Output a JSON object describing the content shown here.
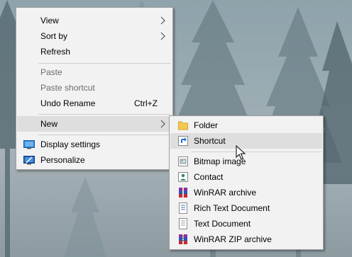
{
  "context_menu": {
    "items": [
      {
        "label": "View"
      },
      {
        "label": "Sort by"
      },
      {
        "label": "Refresh"
      },
      {
        "label": "Paste"
      },
      {
        "label": "Paste shortcut"
      },
      {
        "label": "Undo Rename",
        "shortcut": "Ctrl+Z"
      },
      {
        "label": "New"
      },
      {
        "label": "Display settings"
      },
      {
        "label": "Personalize"
      }
    ]
  },
  "new_submenu": {
    "items": [
      {
        "label": "Folder",
        "icon": "folder-icon"
      },
      {
        "label": "Shortcut",
        "icon": "shortcut-icon"
      },
      {
        "label": "Bitmap image",
        "icon": "bitmap-image-icon"
      },
      {
        "label": "Contact",
        "icon": "contact-icon"
      },
      {
        "label": "WinRAR archive",
        "icon": "winrar-archive-icon"
      },
      {
        "label": "Rich Text Document",
        "icon": "rich-text-document-icon"
      },
      {
        "label": "Text Document",
        "icon": "text-document-icon"
      },
      {
        "label": "WinRAR ZIP archive",
        "icon": "winrar-zip-archive-icon"
      }
    ]
  },
  "colors": {
    "menu_background": "#f2f2f2",
    "highlight": "#dedede",
    "disabled_text": "#6d6d6d",
    "folder_yellow": "#f3c94f"
  }
}
